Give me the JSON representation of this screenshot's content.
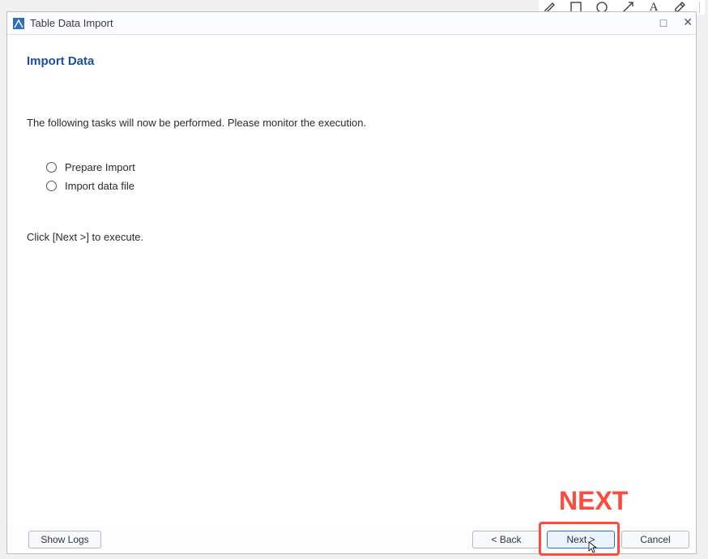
{
  "floating_toolbar": {
    "tools": [
      "pencil",
      "square",
      "circle",
      "arrow",
      "text",
      "eyedropper"
    ]
  },
  "window": {
    "title": "Table Data Import",
    "controls": {
      "maximize": "□",
      "close": "✕"
    }
  },
  "page": {
    "heading": "Import Data",
    "intro": "The following tasks will now be performed. Please monitor the execution.",
    "tasks": {
      "0": {
        "label": "Prepare Import"
      },
      "1": {
        "label": "Import data file"
      }
    },
    "execute_hint": "Click [Next >] to execute."
  },
  "buttons": {
    "show_logs": "Show Logs",
    "back": "< Back",
    "next": "Next >",
    "cancel": "Cancel"
  },
  "annotation": {
    "next_label": "NEXT"
  }
}
